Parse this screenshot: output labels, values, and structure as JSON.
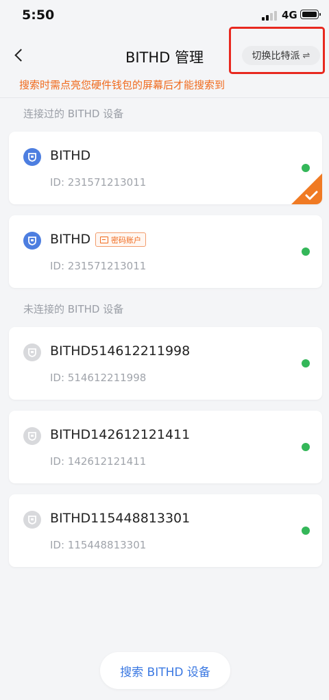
{
  "status_bar": {
    "time": "5:50",
    "network": "4G"
  },
  "header": {
    "title": "BITHD 管理",
    "switch_label": "切换比特派",
    "switch_icon": "⇌"
  },
  "hint": "搜索时需点亮您硬件钱包的屏幕后才能搜索到",
  "sections": {
    "connected_title": "连接过的 BITHD 设备",
    "unconnected_title": "未连接的 BITHD 设备"
  },
  "devices": [
    {
      "name": "BITHD",
      "id": "ID: 231571213011",
      "selected": true,
      "icon": "bithd-shield-icon"
    },
    {
      "name": "BITHD",
      "id": "ID: 231571213011",
      "tag": "密码账户",
      "icon": "bithd-shield-icon"
    },
    {
      "name": "BITHD514612211998",
      "id": "ID: 514612211998",
      "icon": "bithd-shield-icon-gray"
    },
    {
      "name": "BITHD142612121411",
      "id": "ID: 142612121411",
      "icon": "bithd-shield-icon-gray"
    },
    {
      "name": "BITHD115448813301",
      "id": "ID: 115448813301",
      "icon": "bithd-shield-icon-gray"
    }
  ],
  "search_button": "搜索 BITHD 设备",
  "colors": {
    "accent": "#3a78e2",
    "warning": "#f06a1d",
    "online": "#34b759",
    "highlight": "#e8281f",
    "brand_icon": "#4d7ee0"
  }
}
